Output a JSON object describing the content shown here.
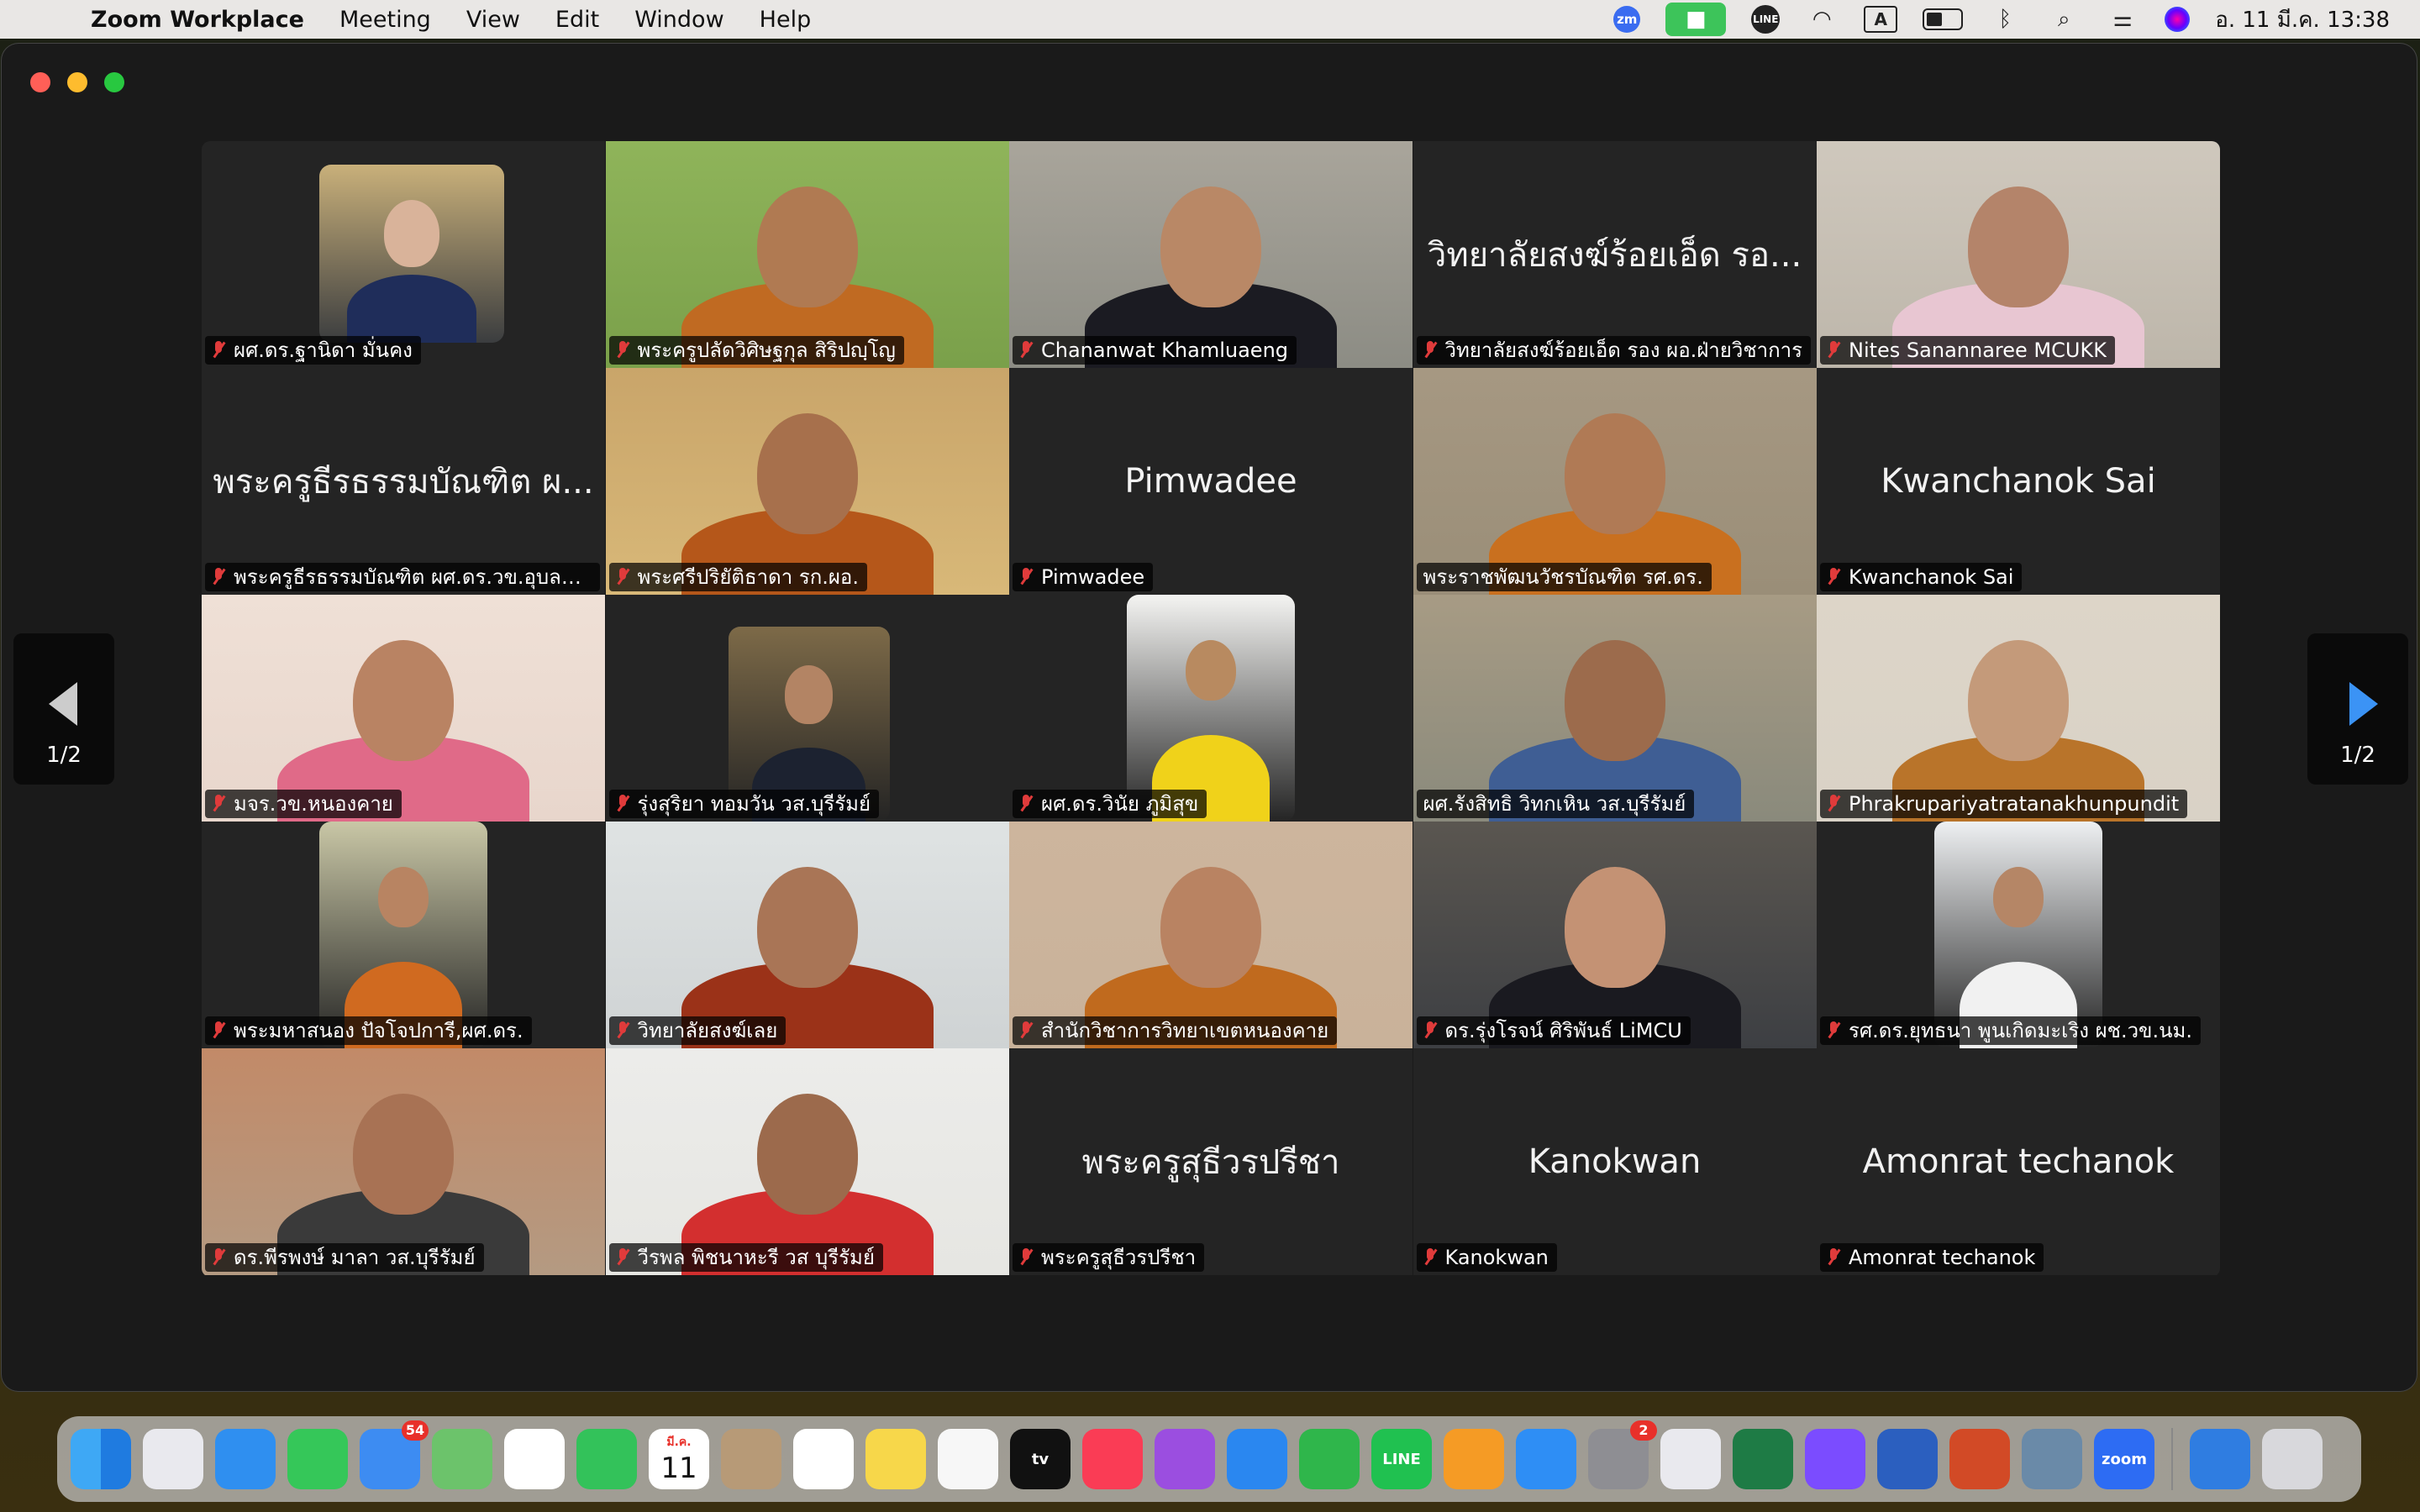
{
  "menubar": {
    "app_name": "Zoom Workplace",
    "menus": [
      "Meeting",
      "View",
      "Edit",
      "Window",
      "Help"
    ],
    "status_icons": [
      "zoom-status-icon",
      "camera-in-use-icon",
      "line-icon",
      "wifi-icon",
      "input-source-icon",
      "battery-icon",
      "bluetooth-icon",
      "spotlight-icon",
      "control-center-icon",
      "siri-icon"
    ],
    "input_source": "A",
    "zoom_label": "zm",
    "line_label": "LINE",
    "clock": "อ. 11 มี.ค.  13:38"
  },
  "pager": {
    "left_label": "1/2",
    "right_label": "1/2"
  },
  "participants": [
    {
      "name": "ผศ.ดร.ฐานิดา มั่นคง",
      "muted": true,
      "video": true,
      "big": ""
    },
    {
      "name": "พระครูปลัดวิศิษฐกุล สิริปญฺโญ",
      "muted": true,
      "video": true,
      "big": ""
    },
    {
      "name": "Chananwat Khamluaeng",
      "muted": true,
      "video": true,
      "big": ""
    },
    {
      "name": "วิทยาลัยสงฆ์ร้อยเอ็ด รอง ผอ.ฝ่ายวิชาการ",
      "muted": true,
      "video": false,
      "big": "วิทยาลัยสงฆ์ร้อยเอ็ด รอ..."
    },
    {
      "name": "Nites Sanannaree MCUKK",
      "muted": true,
      "video": true,
      "big": ""
    },
    {
      "name": "พระครูธีรธรรมบัณฑิต ผศ.ดร.วข.อุบลรา...",
      "muted": true,
      "video": false,
      "big": "พระครูธีรธรรมบัณฑิต ผ..."
    },
    {
      "name": "พระศรีปริยัติธาดา รก.ผอ.",
      "muted": true,
      "video": true,
      "big": ""
    },
    {
      "name": "Pimwadee",
      "muted": true,
      "video": false,
      "big": "Pimwadee"
    },
    {
      "name": "พระราชพัฒนวัชรบัณฑิต รศ.ดร.",
      "muted": false,
      "video": true,
      "big": "",
      "active": true
    },
    {
      "name": "Kwanchanok Sai",
      "muted": true,
      "video": false,
      "big": "Kwanchanok Sai"
    },
    {
      "name": "มจร.วข.หนองคาย",
      "muted": true,
      "video": true,
      "big": ""
    },
    {
      "name": "รุ่งสุริยา ทอมวัน วส.บุรีรัมย์",
      "muted": true,
      "video": true,
      "big": ""
    },
    {
      "name": "ผศ.ดร.วินัย ภูมิสุข",
      "muted": true,
      "video": true,
      "big": ""
    },
    {
      "name": "ผศ.รังสิทธิ  วิทกเหิน วส.บุรีรัมย์",
      "muted": false,
      "video": true,
      "big": ""
    },
    {
      "name": "Phrakrupariyatratanakhunpundit",
      "muted": true,
      "video": true,
      "big": ""
    },
    {
      "name": "พระมหาสนอง ปัจโจปการี,ผศ.ดร.",
      "muted": true,
      "video": true,
      "big": ""
    },
    {
      "name": "วิทยาลัยสงฆ์เลย",
      "muted": true,
      "video": true,
      "big": ""
    },
    {
      "name": "สำนักวิชาการวิทยาเขตหนองคาย",
      "muted": true,
      "video": true,
      "big": ""
    },
    {
      "name": "ดร.รุ่งโรจน์  ศิริพันธ์ LiMCU",
      "muted": true,
      "video": true,
      "big": ""
    },
    {
      "name": "รศ.ดร.ยุทธนา พูนเกิดมะเริง ผช.วข.นม.",
      "muted": true,
      "video": true,
      "big": ""
    },
    {
      "name": "ดร.พีรพงษ์  มาลา วส.บุรีรัมย์",
      "muted": true,
      "video": true,
      "big": ""
    },
    {
      "name": "วีรพล พิชนาหะรี วส บุรีรัมย์",
      "muted": true,
      "video": true,
      "big": ""
    },
    {
      "name": "พระครูสุธีวรปรีชา",
      "muted": true,
      "video": false,
      "big": "พระครูสุธีวรปรีชา"
    },
    {
      "name": "Kanokwan",
      "muted": true,
      "video": false,
      "big": "Kanokwan"
    },
    {
      "name": "Amonrat techanok",
      "muted": true,
      "video": false,
      "big": "Amonrat techanok"
    }
  ],
  "dock": {
    "apps": [
      "finder",
      "launchpad",
      "safari",
      "messages",
      "mail",
      "maps",
      "photos",
      "facetime",
      "calendar",
      "contacts",
      "reminders",
      "notes",
      "freeform",
      "tv",
      "music",
      "podcasts",
      "keynote",
      "numbers",
      "line",
      "pages",
      "app-store",
      "system-settings",
      "preview",
      "excel",
      "messenger",
      "word",
      "powerpoint",
      "image-capture",
      "zoom",
      "downloads",
      "trash"
    ],
    "mail_badge": "54",
    "settings_badge": "2",
    "calendar_month": "มี.ค.",
    "calendar_day": "11",
    "zoom_label": "zoom",
    "line_label": "LINE",
    "tv_label": "tv"
  }
}
